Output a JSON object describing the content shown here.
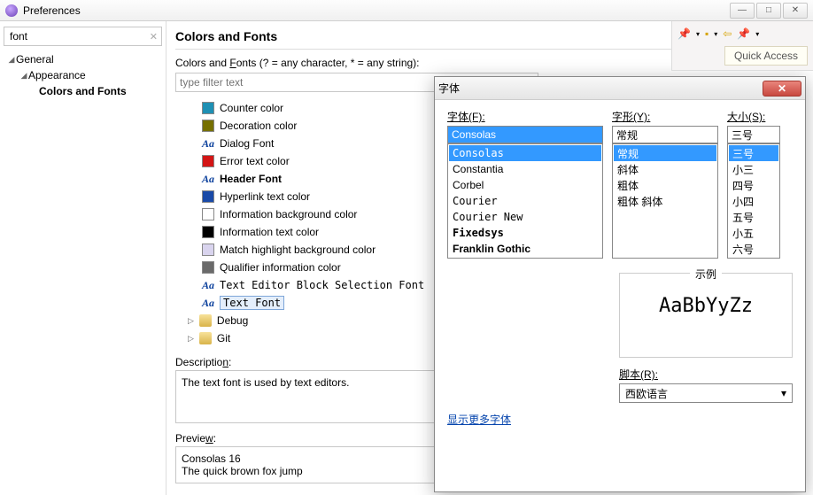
{
  "window": {
    "title": "Preferences"
  },
  "left": {
    "filter": "font",
    "tree": {
      "general": "General",
      "appearance": "Appearance",
      "colorsFonts": "Colors and Fonts"
    }
  },
  "page": {
    "title": "Colors and Fonts",
    "hint_pre": "Colors and ",
    "hint_key": "F",
    "hint_post": "onts (? = any character, * = any string):",
    "filterPlaceholder": "type filter text",
    "items": [
      {
        "label": "Counter color",
        "kind": "color",
        "color": "#1e90b4"
      },
      {
        "label": "Decoration color",
        "kind": "color",
        "color": "#767000"
      },
      {
        "label": "Dialog Font",
        "kind": "font"
      },
      {
        "label": "Error text color",
        "kind": "color",
        "color": "#d31515"
      },
      {
        "label": "Header Font",
        "kind": "font",
        "bold": true
      },
      {
        "label": "Hyperlink text color",
        "kind": "color",
        "color": "#1a4aa8"
      },
      {
        "label": "Information background color",
        "kind": "color",
        "color": "#ffffff"
      },
      {
        "label": "Information text color",
        "kind": "color",
        "color": "#000000"
      },
      {
        "label": "Match highlight background color",
        "kind": "color",
        "color": "#d9d4ee"
      },
      {
        "label": "Qualifier information color",
        "kind": "color",
        "color": "#6a6a6a"
      },
      {
        "label": "Text Editor Block Selection Font",
        "kind": "font",
        "mono": true
      },
      {
        "label": "Text Font",
        "kind": "font",
        "mono": true,
        "selected": true
      }
    ],
    "folders": [
      "Debug",
      "Git"
    ],
    "descLabel_pre": "Descriptio",
    "descLabel_key": "n",
    "descLabel_post": ":",
    "descText": "The text font is used by text editors.",
    "previewLabel_pre": "Previe",
    "previewLabel_key": "w",
    "previewLabel_post": ":",
    "previewLine1": "Consolas 16",
    "previewLine2": "The quick brown fox jump"
  },
  "fontDialog": {
    "title": "字体",
    "fontLabel": "字体(F):",
    "fontValue": "Consolas",
    "fontOptions": [
      {
        "t": "Consolas",
        "sel": true,
        "mono": true
      },
      {
        "t": "Constantia"
      },
      {
        "t": "Corbel"
      },
      {
        "t": "Courier",
        "mono": true
      },
      {
        "t": "Courier New",
        "mono": true
      },
      {
        "t": "Fixedsys",
        "mono": true,
        "bold": true
      },
      {
        "t": "Franklin Gothic",
        "bold": true
      }
    ],
    "styleLabel": "字形(Y):",
    "styleValue": "常规",
    "styleOptions": [
      {
        "t": "常规",
        "sel": true
      },
      {
        "t": "斜体"
      },
      {
        "t": "粗体"
      },
      {
        "t": "粗体 斜体"
      }
    ],
    "sizeLabel": "大小(S):",
    "sizeValue": "三号",
    "sizeOptions": [
      {
        "t": "三号",
        "sel": true
      },
      {
        "t": "小三"
      },
      {
        "t": "四号"
      },
      {
        "t": "小四"
      },
      {
        "t": "五号"
      },
      {
        "t": "小五"
      },
      {
        "t": "六号"
      }
    ],
    "sampleLabel": "示例",
    "sampleText": "AaBbYyZz",
    "scriptLabel": "脚本(R):",
    "scriptValue": "西欧语言",
    "moreFonts": "显示更多字体"
  },
  "rightStrip": {
    "quickAccess": "Quick Access"
  }
}
